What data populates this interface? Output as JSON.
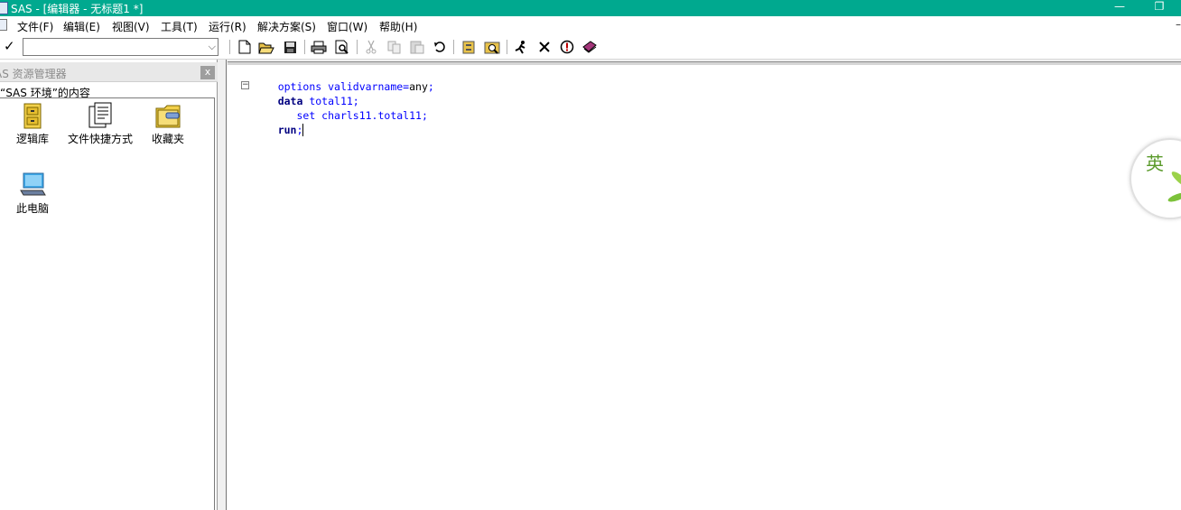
{
  "window": {
    "title": "SAS - [编辑器 - 无标题1 *]",
    "minimize_glyph": "—",
    "restore_glyph": "❐"
  },
  "menu": {
    "items": [
      "文件(F)",
      "编辑(E)",
      "视图(V)",
      "工具(T)",
      "运行(R)",
      "解决方案(S)",
      "窗口(W)",
      "帮助(H)"
    ],
    "mdi_restore_glyph": "–"
  },
  "toolbar": {
    "command_value": "",
    "icons": [
      "new-icon",
      "open-icon",
      "save-icon",
      "print-icon",
      "print-preview-icon",
      "cut-icon",
      "copy-icon",
      "paste-icon",
      "undo-icon",
      "libraries-icon",
      "explorer-icon",
      "submit-icon",
      "clear-icon",
      "break-icon",
      "help-icon"
    ]
  },
  "explorer": {
    "title": "AS 资源管理器",
    "subtitle": "“SAS 环境”的内容",
    "close_glyph": "x",
    "items": [
      {
        "label": "逻辑库",
        "icon": "library-drawer-icon"
      },
      {
        "label": "文件快捷方式",
        "icon": "file-shortcut-icon"
      },
      {
        "label": "收藏夹",
        "icon": "favorites-folder-icon"
      },
      {
        "label": "此电脑",
        "icon": "computer-icon"
      }
    ]
  },
  "editor": {
    "lines": [
      {
        "tokens": [
          {
            "t": "options validvarname=",
            "c": "blue"
          },
          {
            "t": "any",
            "c": "plain"
          },
          {
            "t": ";",
            "c": "blue"
          }
        ]
      },
      {
        "tokens": [
          {
            "t": "data",
            "c": "navy"
          },
          {
            "t": " total11;",
            "c": "blue"
          }
        ]
      },
      {
        "tokens": [
          {
            "t": "   set charls11.total11;",
            "c": "blue"
          }
        ]
      },
      {
        "tokens": [
          {
            "t": "run",
            "c": "navy"
          },
          {
            "t": ";",
            "c": "blue"
          }
        ]
      }
    ],
    "fold_glyph": "−"
  },
  "badge": {
    "glyph": "英"
  },
  "colors": {
    "titlebar": "#00a98f",
    "keyword_navy": "#000080",
    "code_blue": "#0000ff"
  }
}
